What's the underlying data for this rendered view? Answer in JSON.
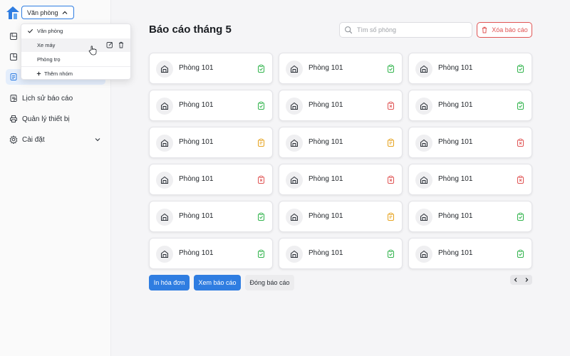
{
  "group_selector": {
    "value": "Văn phòng"
  },
  "dropdown": {
    "items": [
      {
        "label": "Văn phòng",
        "selected": true
      },
      {
        "label": "Xe máy",
        "hovered": true
      },
      {
        "label": "Phòng trọ"
      }
    ],
    "add_label": "Thêm nhóm"
  },
  "sidebar": {
    "items": [
      {
        "label": "Lịch sử báo cáo",
        "icon": "history-icon"
      },
      {
        "label": "Quản lý thiết bị",
        "icon": "printer-icon"
      },
      {
        "label": "Cài đặt",
        "icon": "gear-icon"
      }
    ]
  },
  "page": {
    "title": "Báo cáo tháng 5",
    "search_placeholder": "Tìm số phòng",
    "delete_label": "Xóa báo cáo"
  },
  "rooms": [
    {
      "name": "Phòng 101",
      "status": "done"
    },
    {
      "name": "Phòng 101",
      "status": "done"
    },
    {
      "name": "Phòng 101",
      "status": "done"
    },
    {
      "name": "Phòng 101",
      "status": "done"
    },
    {
      "name": "Phòng 101",
      "status": "error"
    },
    {
      "name": "Phòng 101",
      "status": "done"
    },
    {
      "name": "Phòng 101",
      "status": "pending"
    },
    {
      "name": "Phòng 101",
      "status": "pending"
    },
    {
      "name": "Phòng 101",
      "status": "error"
    },
    {
      "name": "Phòng 101",
      "status": "error"
    },
    {
      "name": "Phòng 101",
      "status": "error"
    },
    {
      "name": "Phòng 101",
      "status": "error"
    },
    {
      "name": "Phòng 101",
      "status": "done"
    },
    {
      "name": "Phòng 101",
      "status": "pending"
    },
    {
      "name": "Phòng 101",
      "status": "done"
    },
    {
      "name": "Phòng 101",
      "status": "done"
    },
    {
      "name": "Phòng 101",
      "status": "done"
    },
    {
      "name": "Phòng 101",
      "status": "done"
    }
  ],
  "status_colors": {
    "done": "#2fb34a",
    "error": "#e05454",
    "pending": "#e6a21c"
  },
  "buttons": {
    "print_invoice": "In hóa đơn",
    "view_report": "Xem báo cáo",
    "close_report": "Đóng báo cáo"
  },
  "colors": {
    "accent": "#2f7de1",
    "danger": "#e05454"
  }
}
